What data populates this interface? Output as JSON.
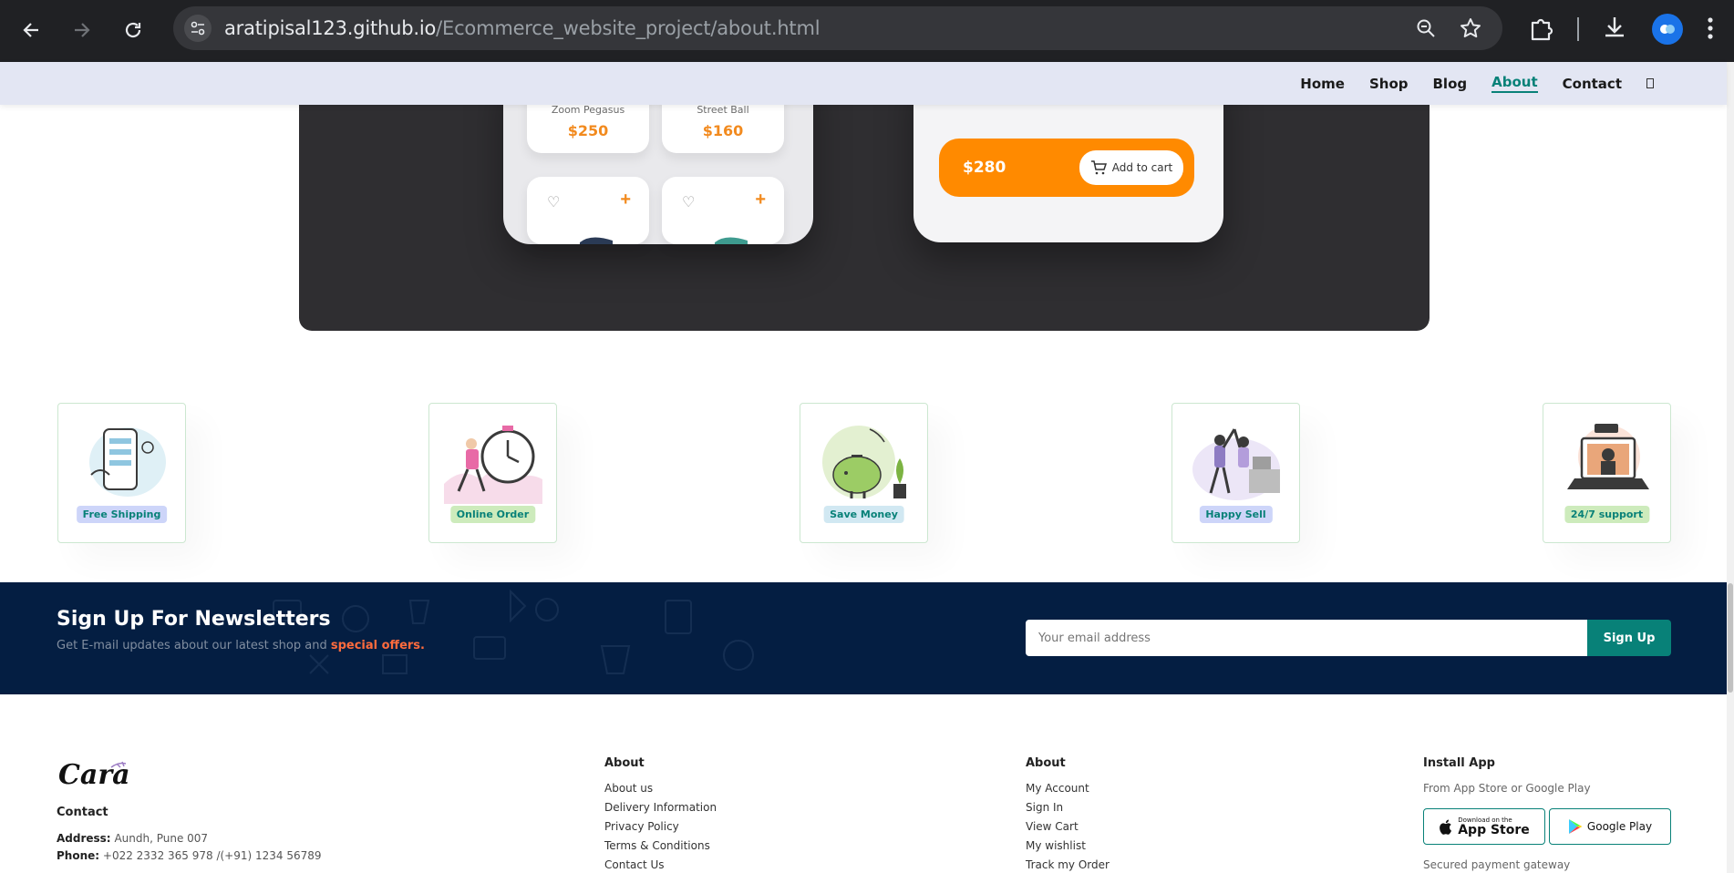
{
  "browser": {
    "url_host": "aratipisal123.github.io",
    "url_path": "/Ecommerce_website_project/about.html"
  },
  "nav": {
    "items": [
      "Home",
      "Shop",
      "Blog",
      "About",
      "Contact"
    ],
    "active": "About"
  },
  "hero": {
    "products": [
      {
        "name": "Nike\nZoom Pegasus",
        "price": "$250"
      },
      {
        "name": "Adidas\nStreet Ball",
        "price": "$160"
      }
    ],
    "cart_price": "$280",
    "add_to_cart": "Add to cart"
  },
  "features": [
    {
      "label": "Free Shipping",
      "color": "#cdd5f9"
    },
    {
      "label": "Online Order",
      "color": "#cdebbc"
    },
    {
      "label": "Save Money",
      "color": "#d1e8f2"
    },
    {
      "label": "Happy Sell",
      "color": "#cdd5f9"
    },
    {
      "label": "24/7 support",
      "color": "#cdebbc"
    }
  ],
  "newsletter": {
    "title": "Sign Up For Newsletters",
    "text": "Get E-mail updates about our latest shop and",
    "highlight": "special offers.",
    "placeholder": "Your email address",
    "button": "Sign Up"
  },
  "footer": {
    "logo": "Cara",
    "contact_heading": "Contact",
    "address_label": "Address:",
    "address": "Aundh, Pune 007",
    "phone_label": "Phone:",
    "phone": "+022 2332 365 978 /(+91) 1234 56789",
    "col1": {
      "heading": "About",
      "links": [
        "About us",
        "Delivery Information",
        "Privacy Policy",
        "Terms & Conditions",
        "Contact Us"
      ]
    },
    "col2": {
      "heading": "About",
      "links": [
        "My Account",
        "Sign In",
        "View Cart",
        "My wishlist",
        "Track my Order"
      ]
    },
    "install": {
      "heading": "Install App",
      "subtitle": "From App Store or Google Play",
      "appstore_small": "Download on the",
      "appstore": "App Store",
      "googleplay": "Google Play",
      "secured": "Secured payment gateway"
    }
  },
  "colors": {
    "accent": "#088178",
    "header_bg": "#e3e6f3",
    "newsletter_bg": "#041e42",
    "orange": "#ff8a00"
  }
}
